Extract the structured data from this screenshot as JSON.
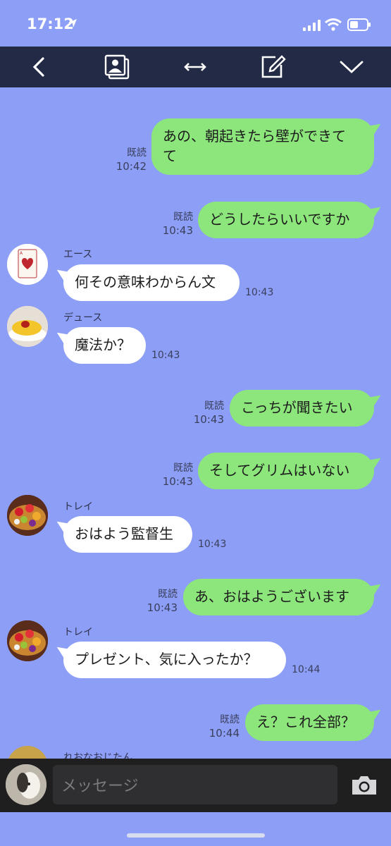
{
  "status_bar": {
    "time": "17:12"
  },
  "toolbar": {
    "icons": [
      "back-icon",
      "album-icon",
      "expand-icon",
      "compose-icon",
      "chevron-down-icon"
    ]
  },
  "messages": [
    {
      "dir": "out",
      "text_lines": [
        "あの、朝起きたら壁ができて",
        "て"
      ],
      "read": "既読",
      "time": "10:42"
    },
    {
      "dir": "out",
      "text": "どうしたらいいですか",
      "read": "既読",
      "time": "10:43"
    },
    {
      "dir": "in",
      "sender": "エース",
      "text": "何その意味わからん文",
      "time": "10:43"
    },
    {
      "dir": "in",
      "sender": "デュース",
      "text": "魔法か？",
      "time": "10:43"
    },
    {
      "dir": "out",
      "text": "こっちが聞きたい",
      "read": "既読",
      "time": "10:43"
    },
    {
      "dir": "out",
      "text": "そしてグリムはいない",
      "read": "既読",
      "time": "10:43"
    },
    {
      "dir": "in",
      "sender": "トレイ",
      "text": "おはよう監督生",
      "time": "10:43"
    },
    {
      "dir": "out",
      "text": "あ、おはようございます",
      "read": "既読",
      "time": "10:43"
    },
    {
      "dir": "in",
      "sender": "トレイ",
      "text": "プレゼント、気に入ったか？",
      "time": "10:44"
    },
    {
      "dir": "out",
      "text": "え？これ全部？",
      "read": "既読",
      "time": "10:44"
    },
    {
      "dir": "in",
      "sender": "れおなおじたん"
    }
  ],
  "input": {
    "placeholder": "メッセージ"
  },
  "colors": {
    "background": "#8c9ef5",
    "toolbar": "#232a46",
    "outgoing": "#8de67c",
    "incoming": "#ffffff",
    "input_bar": "#1f1f1f"
  }
}
